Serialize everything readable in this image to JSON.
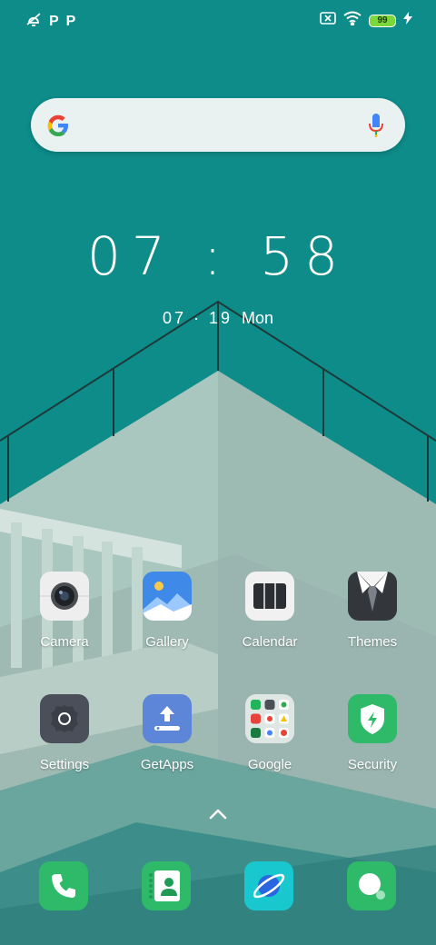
{
  "status_bar": {
    "left_icons": [
      "alarm-off-icon",
      "parking-app-icon",
      "parking-app-icon"
    ],
    "p1": "P",
    "p2": "P",
    "right_icons": [
      "sim-error-icon",
      "wifi-icon",
      "battery-icon",
      "charging-icon"
    ],
    "battery_level": "99"
  },
  "search": {
    "logo": "google-g-icon",
    "mic": "microphone-icon"
  },
  "clock": {
    "time": "07 : 58",
    "date": "07 · 19",
    "weekday": "Mon"
  },
  "apps": [
    {
      "label": "Camera",
      "icon": "camera-icon"
    },
    {
      "label": "Gallery",
      "icon": "gallery-icon"
    },
    {
      "label": "Calendar",
      "icon": "calendar-icon"
    },
    {
      "label": "Themes",
      "icon": "themes-icon"
    },
    {
      "label": "Settings",
      "icon": "settings-icon"
    },
    {
      "label": "GetApps",
      "icon": "getapps-icon"
    },
    {
      "label": "Google",
      "icon": "google-folder-icon"
    },
    {
      "label": "Security",
      "icon": "security-icon"
    }
  ],
  "dock": [
    {
      "icon": "phone-icon"
    },
    {
      "icon": "contacts-icon"
    },
    {
      "icon": "browser-icon"
    },
    {
      "icon": "messaging-icon"
    }
  ],
  "colors": {
    "wallpaper_teal": "#0e8c8a",
    "app_green": "#2fba6a",
    "gallery_blue": "#3f8ae8",
    "getapps_blue": "#5e86d8",
    "browser_cyan": "#19c8cf"
  }
}
